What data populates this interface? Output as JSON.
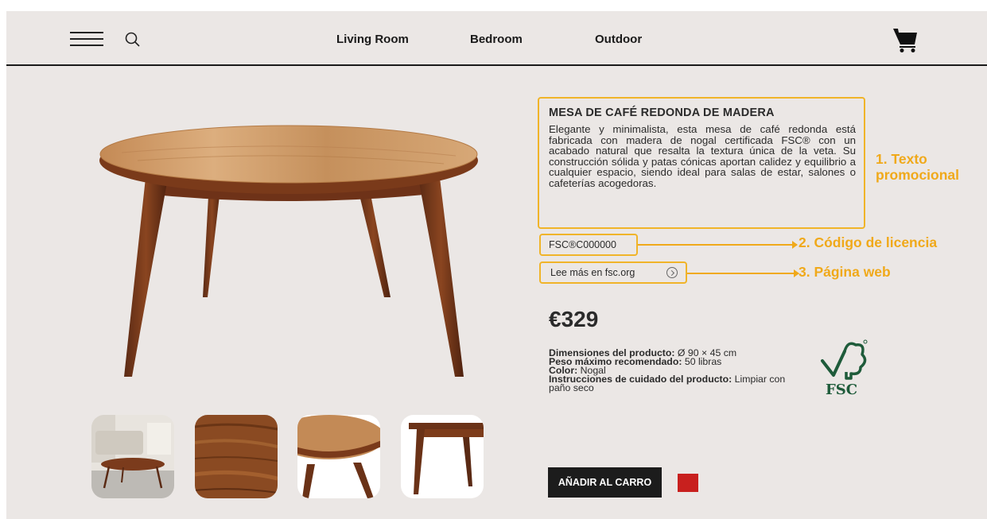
{
  "nav": {
    "links": [
      "Living Room",
      "Bedroom",
      "Outdoor"
    ]
  },
  "product": {
    "title": "MESA DE CAFÉ REDONDA DE MADERA",
    "description": "Elegante y minimalista, esta mesa de café redonda está fabricada con madera de nogal certificada FSC® con un acabado natural que resalta la textura única de la veta. Su construcción sólida y patas cónicas aportan calidez y equilibrio a cualquier espacio, siendo ideal para salas de estar, salones o cafeterías acogedoras.",
    "license_code": "FSC®C000000",
    "web_link": "Lee más en  fsc.org",
    "price": "€329",
    "specs": [
      {
        "label": "Dimensiones del producto:",
        "value": " Ø 90 × 45 cm"
      },
      {
        "label": "Peso máximo recomendado:",
        "value": " 50 libras"
      },
      {
        "label": "Color:",
        "value": " Nogal"
      },
      {
        "label": "Instrucciones de cuidado del producto:",
        "value": " Limpiar con paño seco"
      }
    ],
    "add_to_cart_label": "AÑADIR AL CARRO",
    "swatch_color": "#c8201e",
    "fsc_logo_text": "FSC"
  },
  "annotations": {
    "promo_line1": "1. Texto",
    "promo_line2": "promocional",
    "license": "2. Código de licencia",
    "web": "3. Página web"
  },
  "colors": {
    "accent": "#f0a91a",
    "background": "#ebe7e5",
    "button": "#1c1c1c"
  },
  "icons": [
    "menu-icon",
    "search-icon",
    "cart-icon",
    "arrow-circle-icon",
    "fsc-tree-icon"
  ]
}
